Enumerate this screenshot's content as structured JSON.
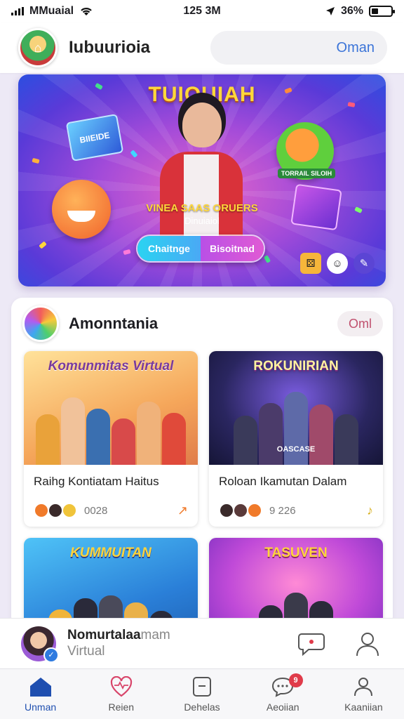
{
  "status_bar": {
    "carrier": "MMuaial",
    "time": "125 3M",
    "battery": "36%",
    "battery_level": 0.36
  },
  "header": {
    "title": "Iubuurioia",
    "search_label": "Oman"
  },
  "hero": {
    "title": "TUIOUIAH",
    "card_left_text": "BIIEIDE",
    "sticker_right": "TORRAIL SILOIH",
    "caption_line1": "VINEA SAAS ORUERS",
    "caption_line2": "Dinuiaiol",
    "button_left": "Chaitnge",
    "button_right": "Bisoitnad"
  },
  "community": {
    "title": "Amonntania",
    "pill": "Oml",
    "cards": [
      {
        "image_title": "Komunmitas Virtual",
        "image_sub": "",
        "caption": "Raihg Kontiatam Haitus",
        "count": "0028",
        "trail_icon": "arrow-icon"
      },
      {
        "image_title": "ROKUNIRIAN",
        "image_sub": "OASCASE",
        "caption": "Roloan Ikamutan Dalam",
        "count": "9 226",
        "trail_icon": "music-note-icon"
      },
      {
        "image_title": "KUMMUITAN",
        "image_sub": "",
        "caption": "",
        "count": "",
        "trail_icon": ""
      },
      {
        "image_title": "TASUVEN",
        "image_sub": "",
        "caption": "",
        "count": "",
        "trail_icon": ""
      }
    ]
  },
  "mini_profile": {
    "name": "Nomurtalaa",
    "name_suffix": "mam",
    "subtitle": "Virtual"
  },
  "nav": {
    "items": [
      {
        "label": "Unman",
        "icon": "home-icon"
      },
      {
        "label": "Reien",
        "icon": "heart-icon"
      },
      {
        "label": "Dehelas",
        "icon": "tablet-icon"
      },
      {
        "label": "Aeoiian",
        "icon": "chat-icon",
        "badge": "9"
      },
      {
        "label": "Kaaniian",
        "icon": "profile-icon"
      }
    ]
  },
  "colors": {
    "accent": "#1f4fb0",
    "hero_gold": "#ffd73a",
    "badge": "#e03b4a"
  }
}
